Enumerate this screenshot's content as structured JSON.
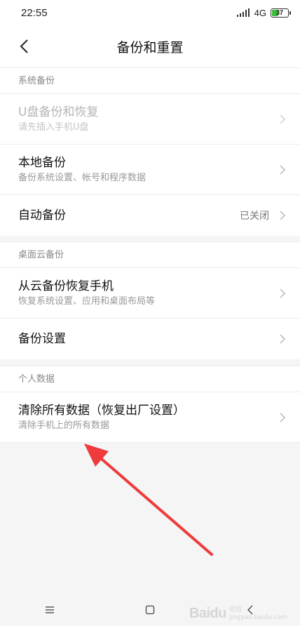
{
  "status_bar": {
    "time": "22:55",
    "network": "4G",
    "battery_level": "37"
  },
  "header": {
    "title": "备份和重置"
  },
  "sections": [
    {
      "title": "系统备份",
      "items": [
        {
          "title": "U盘备份和恢复",
          "subtitle": "请先插入手机U盘",
          "disabled": true
        },
        {
          "title": "本地备份",
          "subtitle": "备份系统设置、帐号和程序数据"
        },
        {
          "title": "自动备份",
          "value": "已关闭"
        }
      ]
    },
    {
      "title": "桌面云备份",
      "items": [
        {
          "title": "从云备份恢复手机",
          "subtitle": "恢复系统设置、应用和桌面布局等"
        },
        {
          "title": "备份设置"
        }
      ]
    },
    {
      "title": "个人数据",
      "items": [
        {
          "title": "清除所有数据（恢复出厂设置）",
          "subtitle": "清除手机上的所有数据"
        }
      ]
    }
  ],
  "nav_bar": {
    "menu_icon": "menu-icon",
    "home_icon": "home-icon",
    "back_icon": "back-icon"
  },
  "watermark": {
    "logo": "Baidu",
    "line1": "经验",
    "line2": "jingyan.baidu.com"
  },
  "colors": {
    "annotation_arrow": "#ee3b3b",
    "battery_fill": "#3bbf3b"
  }
}
